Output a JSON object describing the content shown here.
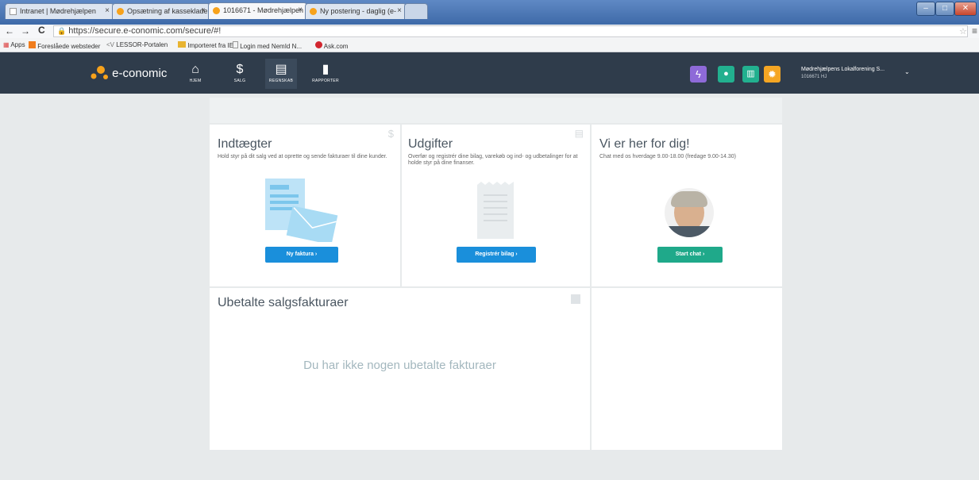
{
  "browser": {
    "tabs": [
      {
        "label": "Intranet | Mødrehjælpen"
      },
      {
        "label": "Opsætning af kasseklade"
      },
      {
        "label": "1016671 - Mødrehjælpen"
      },
      {
        "label": "Ny postering - daglig (e-"
      }
    ],
    "address": "https://secure.e-conomic.com/secure/#!",
    "bookmarks": [
      "Apps",
      "Foreslåede websteder",
      "LESSOR-Portalen",
      "Importeret fra IE",
      "Login med NemId N...",
      "Ask.com"
    ]
  },
  "app": {
    "brand": "e-conomic",
    "nav": [
      {
        "label": "HJEM",
        "icon": "home-icon"
      },
      {
        "label": "SALG",
        "icon": "dollar-icon"
      },
      {
        "label": "REGNSKAB",
        "icon": "ledger-icon"
      },
      {
        "label": "RAPPORTER",
        "icon": "bar-chart-icon"
      }
    ],
    "quick_actions": [
      {
        "icon": "lightning-icon",
        "color": "#8e6ad8"
      },
      {
        "icon": "chat-icon",
        "color": "#22b08f"
      },
      {
        "icon": "book-icon",
        "color": "#22b08f"
      },
      {
        "icon": "gear-icon",
        "color": "#f5a623"
      }
    ],
    "account": {
      "name": "Mødrehjælpens Lokalforening S...",
      "id": "1016671 HJ"
    }
  },
  "cards": {
    "income": {
      "title": "Indtægter",
      "desc": "Hold styr på dit salg ved at oprette og sende fakturaer til dine kunder.",
      "button": "Ny faktura  ›"
    },
    "expenses": {
      "title": "Udgifter",
      "desc": "Overfør og registrér dine bilag, varekøb og ind- og udbetalinger for at holde styr på dine finanser.",
      "button": "Registrér bilag  ›"
    },
    "support": {
      "title": "Vi er her for dig!",
      "desc": "Chat med os hverdage 9.00-18.00 (fredage 9.00-14.30)",
      "button": "Start chat  ›"
    },
    "unpaid": {
      "title": "Ubetalte salgsfakturaer",
      "empty": "Du har ikke nogen ubetalte fakturaer"
    }
  },
  "colors": {
    "primary_button": "#1a8fdb",
    "chat_button": "#1fa98a",
    "appbar": "#2f3c4b"
  }
}
